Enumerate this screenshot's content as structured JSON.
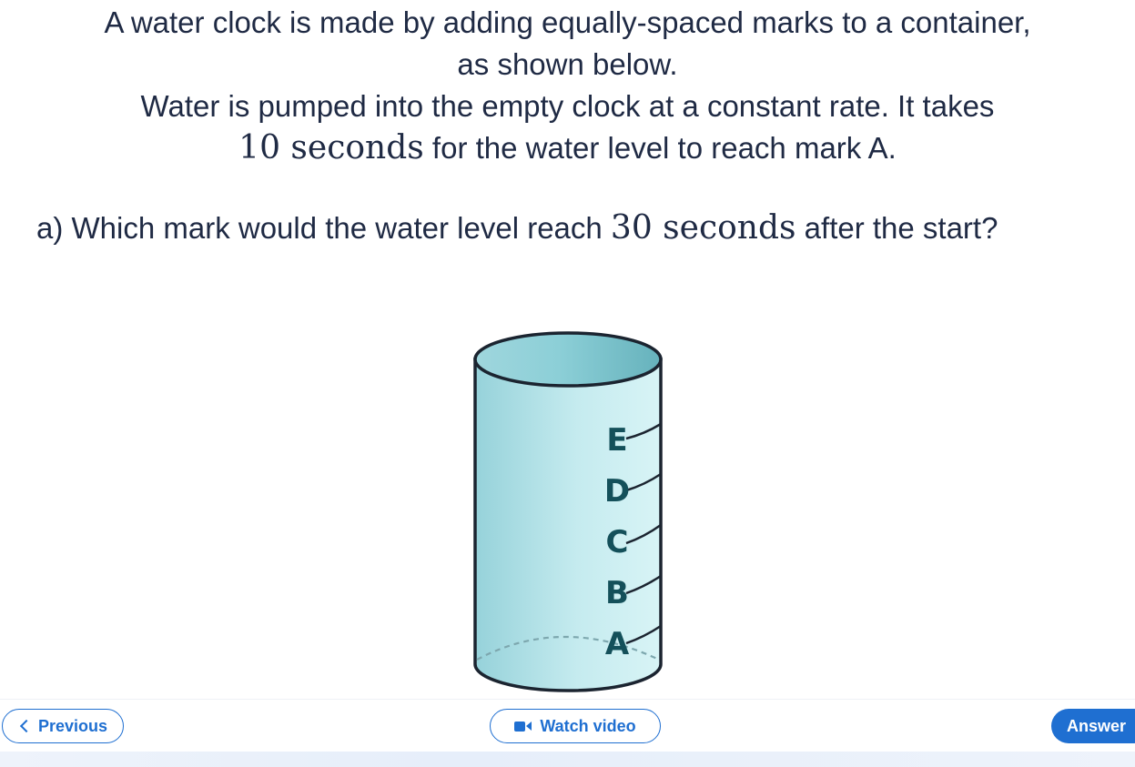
{
  "question": {
    "line1": "A water clock is made by adding equally-spaced marks to a container,",
    "line2": "as shown below.",
    "line3": "Water is pumped into the empty clock at a constant rate. It takes",
    "line4_math": "10 seconds",
    "line4_text": " for the water level to reach mark A.",
    "part_a_prefix": "a) Which mark would the water level reach ",
    "part_a_math": "30 seconds",
    "part_a_suffix": " after the start?"
  },
  "figure": {
    "marks": [
      "A",
      "B",
      "C",
      "D",
      "E"
    ],
    "colors": {
      "water": "#a8dbe2",
      "outline": "#1b2430",
      "label": "#14505a"
    }
  },
  "footer": {
    "previous_label": "Previous",
    "video_label": "Watch video",
    "answer_label": "Answer",
    "accent": "#1f6fd1"
  }
}
